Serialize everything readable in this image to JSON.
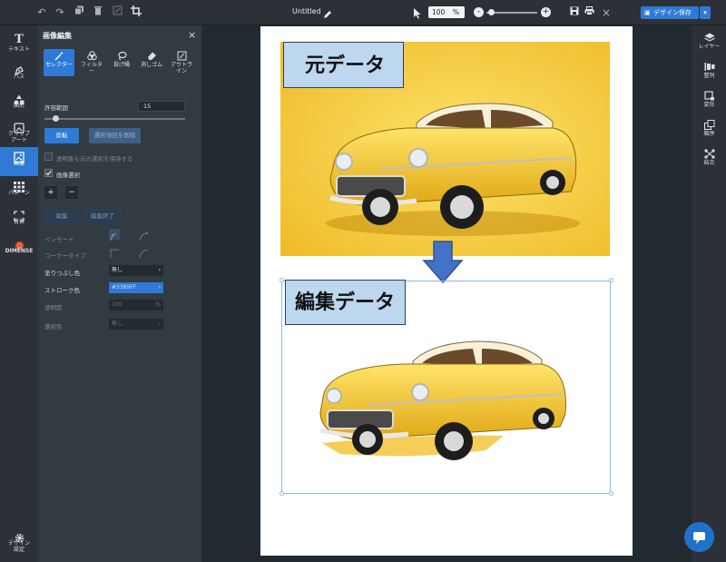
{
  "topbar": {
    "document_title": "Untitled",
    "zoom_value": "100",
    "zoom_unit": "%",
    "zoom_minus": "-",
    "zoom_plus": "+",
    "save_label": "デザイン保存",
    "save_dropdown": "▾"
  },
  "left_rail": {
    "items": [
      {
        "label": "テキスト",
        "icon": "text-icon"
      },
      {
        "label": "パス",
        "icon": "pen-icon"
      },
      {
        "label": "図形",
        "icon": "shapes-icon"
      },
      {
        "label": "クリップ\nアート",
        "icon": "clipart-icon"
      },
      {
        "label": "画像",
        "icon": "image-icon"
      },
      {
        "label": "パターン",
        "icon": "pattern-icon"
      },
      {
        "label": "背景",
        "icon": "background-icon"
      },
      {
        "label": "DIMENSE",
        "icon": "dimense-logo"
      }
    ],
    "settings_label": "デザイン\n設定"
  },
  "panel": {
    "title": "画像編集",
    "close": "×",
    "modes": [
      {
        "label": "セレクター",
        "icon": "magic-wand-icon"
      },
      {
        "label": "フィルタ\nー",
        "icon": "filter-icon"
      },
      {
        "label": "投げ縄",
        "icon": "lasso-icon"
      },
      {
        "label": "消しゴム",
        "icon": "eraser-icon"
      },
      {
        "label": "アウトラ\nイン",
        "icon": "outline-icon"
      }
    ],
    "tolerance_label": "許容範囲",
    "tolerance_value": "15",
    "tolerance_level": 0.06,
    "invert_label": "反転",
    "delete_selection_label": "選択項目を削除",
    "keep_original_label": "透明後も元の選択を保持する",
    "image_select_label": "画像選択",
    "plus": "+",
    "minus": "−",
    "edit_label": "編集",
    "edit_done_label": "編集終了",
    "pen_mode_label": "ペンモード",
    "corner_type_label": "コーナータイプ",
    "fill_color_label": "塗りつぶし色",
    "fill_color_value": "無し",
    "stroke_color_label": "ストローク色",
    "stroke_color_value": "#3389FF",
    "opacity_label": "透明度",
    "opacity_value": "100",
    "opacity_unit": "%",
    "selection_color_label": "選択色",
    "selection_color_value": "無し"
  },
  "canvas": {
    "original_label": "元データ",
    "edited_label": "編集データ"
  },
  "right_rail": {
    "items": [
      {
        "label": "レイヤー",
        "icon": "layers-icon"
      },
      {
        "label": "整列",
        "icon": "align-icon"
      },
      {
        "label": "変形",
        "icon": "transform-icon"
      },
      {
        "label": "順序",
        "icon": "order-icon"
      },
      {
        "label": "結合",
        "icon": "combine-icon"
      }
    ]
  },
  "colors": {
    "accent": "#2f7ad6",
    "panel_bg": "#323a42",
    "rail_bg": "#2b3137",
    "label_fill": "#bdd7ee",
    "car_yellow": "#f4c93a",
    "arrow_blue": "#4472c4"
  }
}
